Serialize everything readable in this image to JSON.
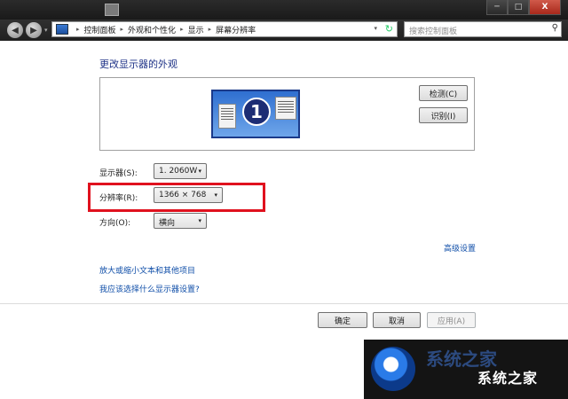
{
  "window": {
    "controls": {
      "minimize": "─",
      "maximize": "□",
      "close": "X"
    }
  },
  "navigation": {
    "back_icon": "back-arrow-icon",
    "forward_icon": "forward-arrow-icon",
    "back_glyph": "◀",
    "forward_glyph": "▶",
    "dropdown_glyph": "▾"
  },
  "address_bar": {
    "breadcrumbs": [
      "控制面板",
      "外观和个性化",
      "显示",
      "屏幕分辨率"
    ],
    "separator": "▸",
    "dropdown_glyph": "▾",
    "refresh_glyph": "↻"
  },
  "search": {
    "placeholder": "搜索控制面板",
    "icon_glyph": "⚲"
  },
  "main": {
    "heading": "更改显示器的外观",
    "preview": {
      "monitor_number": "1",
      "detect_button": "检测(C)",
      "identify_button": "识别(I)"
    },
    "settings": {
      "display": {
        "label": "显示器(S):",
        "value": "1. 2060W"
      },
      "resolution": {
        "label": "分辨率(R):",
        "value": "1366 × 768"
      },
      "orientation": {
        "label": "方向(O):",
        "value": "横向"
      }
    },
    "dropdown_glyph": "▾",
    "advanced_link": "高级设置",
    "links": [
      "放大或缩小文本和其他项目",
      "我应该选择什么显示器设置?"
    ]
  },
  "footer": {
    "ok": "确定",
    "cancel": "取消",
    "apply": "应用(A)"
  },
  "watermark": {
    "blurred_text": "系统之家",
    "text": "系统之家"
  },
  "colors": {
    "heading": "#1e3287",
    "link": "#0f4ea8",
    "highlight": "#e0111e"
  }
}
